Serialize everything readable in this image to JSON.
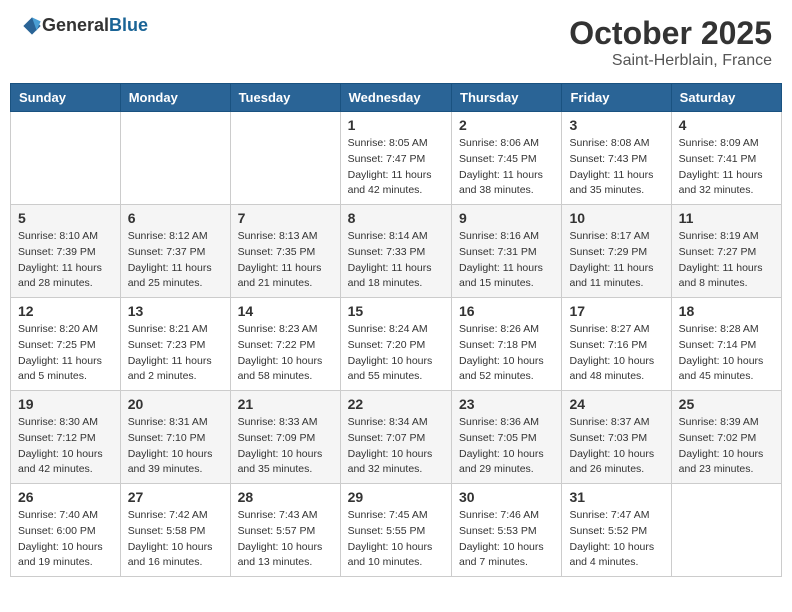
{
  "header": {
    "logo_general": "General",
    "logo_blue": "Blue",
    "month_title": "October 2025",
    "location": "Saint-Herblain, France"
  },
  "days_of_week": [
    "Sunday",
    "Monday",
    "Tuesday",
    "Wednesday",
    "Thursday",
    "Friday",
    "Saturday"
  ],
  "weeks": [
    [
      {
        "day": "",
        "info": ""
      },
      {
        "day": "",
        "info": ""
      },
      {
        "day": "",
        "info": ""
      },
      {
        "day": "1",
        "info": "Sunrise: 8:05 AM\nSunset: 7:47 PM\nDaylight: 11 hours\nand 42 minutes."
      },
      {
        "day": "2",
        "info": "Sunrise: 8:06 AM\nSunset: 7:45 PM\nDaylight: 11 hours\nand 38 minutes."
      },
      {
        "day": "3",
        "info": "Sunrise: 8:08 AM\nSunset: 7:43 PM\nDaylight: 11 hours\nand 35 minutes."
      },
      {
        "day": "4",
        "info": "Sunrise: 8:09 AM\nSunset: 7:41 PM\nDaylight: 11 hours\nand 32 minutes."
      }
    ],
    [
      {
        "day": "5",
        "info": "Sunrise: 8:10 AM\nSunset: 7:39 PM\nDaylight: 11 hours\nand 28 minutes."
      },
      {
        "day": "6",
        "info": "Sunrise: 8:12 AM\nSunset: 7:37 PM\nDaylight: 11 hours\nand 25 minutes."
      },
      {
        "day": "7",
        "info": "Sunrise: 8:13 AM\nSunset: 7:35 PM\nDaylight: 11 hours\nand 21 minutes."
      },
      {
        "day": "8",
        "info": "Sunrise: 8:14 AM\nSunset: 7:33 PM\nDaylight: 11 hours\nand 18 minutes."
      },
      {
        "day": "9",
        "info": "Sunrise: 8:16 AM\nSunset: 7:31 PM\nDaylight: 11 hours\nand 15 minutes."
      },
      {
        "day": "10",
        "info": "Sunrise: 8:17 AM\nSunset: 7:29 PM\nDaylight: 11 hours\nand 11 minutes."
      },
      {
        "day": "11",
        "info": "Sunrise: 8:19 AM\nSunset: 7:27 PM\nDaylight: 11 hours\nand 8 minutes."
      }
    ],
    [
      {
        "day": "12",
        "info": "Sunrise: 8:20 AM\nSunset: 7:25 PM\nDaylight: 11 hours\nand 5 minutes."
      },
      {
        "day": "13",
        "info": "Sunrise: 8:21 AM\nSunset: 7:23 PM\nDaylight: 11 hours\nand 2 minutes."
      },
      {
        "day": "14",
        "info": "Sunrise: 8:23 AM\nSunset: 7:22 PM\nDaylight: 10 hours\nand 58 minutes."
      },
      {
        "day": "15",
        "info": "Sunrise: 8:24 AM\nSunset: 7:20 PM\nDaylight: 10 hours\nand 55 minutes."
      },
      {
        "day": "16",
        "info": "Sunrise: 8:26 AM\nSunset: 7:18 PM\nDaylight: 10 hours\nand 52 minutes."
      },
      {
        "day": "17",
        "info": "Sunrise: 8:27 AM\nSunset: 7:16 PM\nDaylight: 10 hours\nand 48 minutes."
      },
      {
        "day": "18",
        "info": "Sunrise: 8:28 AM\nSunset: 7:14 PM\nDaylight: 10 hours\nand 45 minutes."
      }
    ],
    [
      {
        "day": "19",
        "info": "Sunrise: 8:30 AM\nSunset: 7:12 PM\nDaylight: 10 hours\nand 42 minutes."
      },
      {
        "day": "20",
        "info": "Sunrise: 8:31 AM\nSunset: 7:10 PM\nDaylight: 10 hours\nand 39 minutes."
      },
      {
        "day": "21",
        "info": "Sunrise: 8:33 AM\nSunset: 7:09 PM\nDaylight: 10 hours\nand 35 minutes."
      },
      {
        "day": "22",
        "info": "Sunrise: 8:34 AM\nSunset: 7:07 PM\nDaylight: 10 hours\nand 32 minutes."
      },
      {
        "day": "23",
        "info": "Sunrise: 8:36 AM\nSunset: 7:05 PM\nDaylight: 10 hours\nand 29 minutes."
      },
      {
        "day": "24",
        "info": "Sunrise: 8:37 AM\nSunset: 7:03 PM\nDaylight: 10 hours\nand 26 minutes."
      },
      {
        "day": "25",
        "info": "Sunrise: 8:39 AM\nSunset: 7:02 PM\nDaylight: 10 hours\nand 23 minutes."
      }
    ],
    [
      {
        "day": "26",
        "info": "Sunrise: 7:40 AM\nSunset: 6:00 PM\nDaylight: 10 hours\nand 19 minutes."
      },
      {
        "day": "27",
        "info": "Sunrise: 7:42 AM\nSunset: 5:58 PM\nDaylight: 10 hours\nand 16 minutes."
      },
      {
        "day": "28",
        "info": "Sunrise: 7:43 AM\nSunset: 5:57 PM\nDaylight: 10 hours\nand 13 minutes."
      },
      {
        "day": "29",
        "info": "Sunrise: 7:45 AM\nSunset: 5:55 PM\nDaylight: 10 hours\nand 10 minutes."
      },
      {
        "day": "30",
        "info": "Sunrise: 7:46 AM\nSunset: 5:53 PM\nDaylight: 10 hours\nand 7 minutes."
      },
      {
        "day": "31",
        "info": "Sunrise: 7:47 AM\nSunset: 5:52 PM\nDaylight: 10 hours\nand 4 minutes."
      },
      {
        "day": "",
        "info": ""
      }
    ]
  ]
}
